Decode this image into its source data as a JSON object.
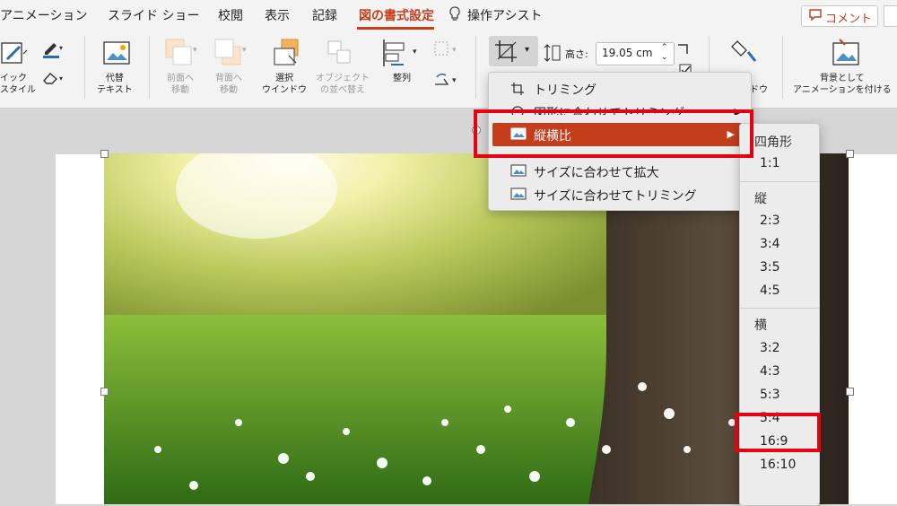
{
  "tabs": {
    "animation": "アニメーション",
    "slideshow": "スライド ショー",
    "review": "校閲",
    "view": "表示",
    "record": "記録",
    "picture_format": "図の書式設定",
    "tell_me": "操作アシスト"
  },
  "comment_button": "コメント",
  "ribbon": {
    "quick_style": "イック\nスタイル",
    "alt_text": "代替\nテキスト",
    "bring_forward": "前面へ\n移動",
    "send_backward": "背面へ\n移動",
    "selection_pane": "選択\nウインドウ",
    "reorder_objects": "オブジェクト\nの並べ替え",
    "align": "整列",
    "height_label": "高さ:",
    "height_value": "19.05 cm",
    "format_pane": "式\nンドウ",
    "set_as_background": "背景として\nアニメーションを付ける"
  },
  "crop_menu": {
    "items": [
      {
        "label": "トリミング"
      },
      {
        "label": "図形に合わせてトリミング"
      },
      {
        "label": "縦横比"
      },
      {
        "label": "サイズに合わせて拡大"
      },
      {
        "label": "サイズに合わせてトリミング"
      }
    ]
  },
  "aspect_submenu": {
    "square_heading": "四角形",
    "square": [
      "1:1"
    ],
    "portrait_heading": "縦",
    "portrait": [
      "2:3",
      "3:4",
      "3:5",
      "4:5"
    ],
    "landscape_heading": "横",
    "landscape": [
      "3:2",
      "4:3",
      "5:3",
      "5:4",
      "16:9",
      "16:10"
    ]
  },
  "colors": {
    "accent": "#c43e1c",
    "highlight_box": "#e60012"
  }
}
